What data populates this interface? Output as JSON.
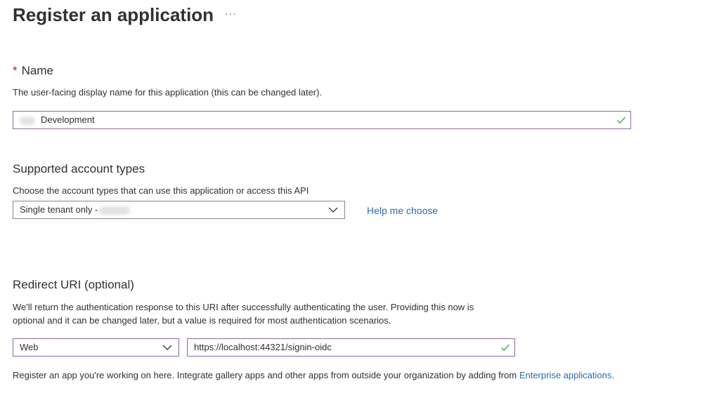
{
  "header": {
    "title": "Register an application",
    "more_icon": "ellipsis-icon",
    "more_label": "···"
  },
  "name_section": {
    "required_marker": "*",
    "title": "Name",
    "description": "The user-facing display name for this application (this can be changed later).",
    "value": "Development",
    "validation_icon": "check-icon"
  },
  "account_types": {
    "title": "Supported account types",
    "description": "Choose the account types that can use this application or access this API",
    "selected": "Single tenant only -",
    "dropdown_icon": "chevron-down-icon",
    "help_link": "Help me choose"
  },
  "redirect": {
    "title": "Redirect URI (optional)",
    "description_line1": "We'll return the authentication response to this URI after successfully authenticating the user. Providing this now is",
    "description_line2": "optional and it can be changed later, but a value is required for most authentication scenarios.",
    "platform": "Web",
    "uri": "https://localhost:44321/signin-oidc",
    "validation_icon": "check-icon"
  },
  "footer": {
    "text": "Register an app you're working on here. Integrate gallery apps and other apps from outside your organization by adding from",
    "link": "Enterprise applications",
    "suffix": "."
  },
  "colors": {
    "accent_link": "#2b6cb0",
    "valid_check": "#4caf50",
    "required_star": "#a4262c",
    "focus_border": "#8a6aa6"
  }
}
